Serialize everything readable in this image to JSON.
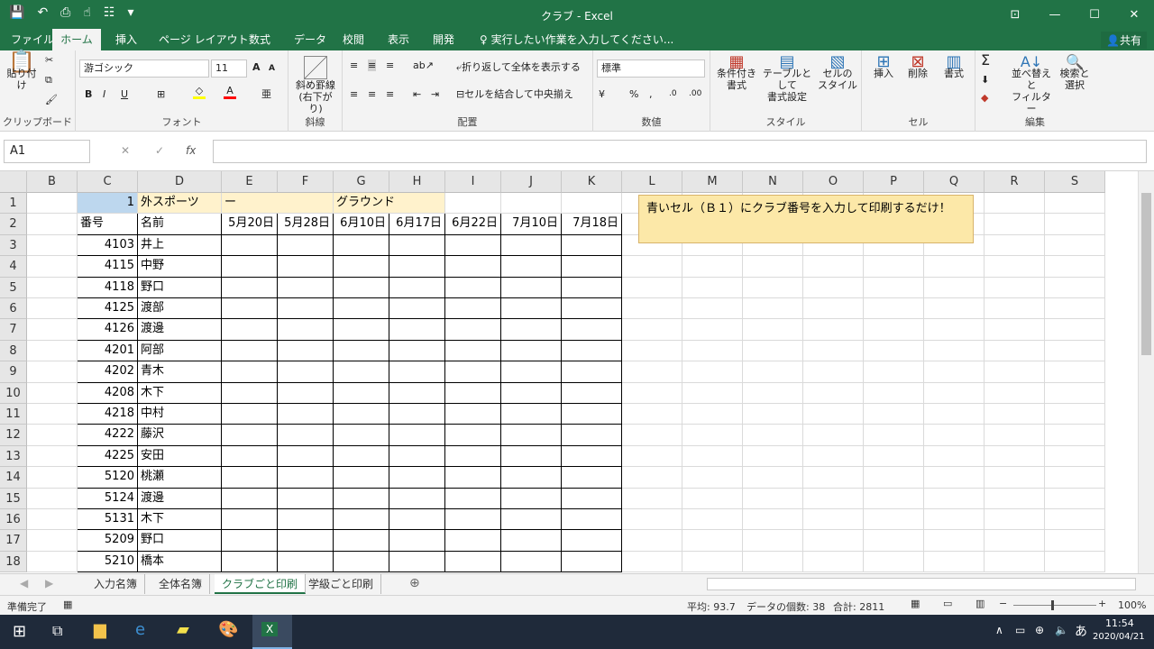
{
  "window": {
    "title": "クラブ - Excel"
  },
  "qat": {
    "save": "💾",
    "undo": "↶",
    "preview": "⎙",
    "touch": "☝",
    "form": "☷",
    "more": "▾"
  },
  "win_buttons": {
    "ribbon_opts": "⊡",
    "min": "—",
    "max": "☐",
    "close": "✕"
  },
  "tabs": [
    "ファイル",
    "ホーム",
    "挿入",
    "ページ レイアウト",
    "数式",
    "データ",
    "校閲",
    "表示",
    "開発"
  ],
  "tell_me": "実行したい作業を入力してください...",
  "share": "共有",
  "ribbon": {
    "clipboard": {
      "paste": "貼り付け",
      "label": "クリップボード"
    },
    "font": {
      "name": "游ゴシック",
      "size": "11",
      "label": "フォント",
      "bold": "B",
      "italic": "I",
      "underline": "U",
      "grow": "A",
      "shrink": "A",
      "fill_char": "◇",
      "font_color_char": "A",
      "fill_color": "#ffff00",
      "font_color": "#ff0000"
    },
    "border": {
      "diag": "斜め罫線",
      "diag2": "(右下がり)",
      "label": "斜線"
    },
    "align": {
      "wrap": "折り返して全体を表示する",
      "merge": "セルを結合して中央揃え",
      "label": "配置"
    },
    "number": {
      "format": "標準",
      "label": "数値",
      "percent": "%",
      "comma": ",",
      "inc": ".0",
      "dec": ".00"
    },
    "style": {
      "cond": "条件付き",
      "cond2": "書式",
      "table": "テーブルとして",
      "table2": "書式設定",
      "cell": "セルの",
      "cell2": "スタイル",
      "label": "スタイル"
    },
    "cells": {
      "insert": "挿入",
      "delete": "削除",
      "format": "書式",
      "label": "セル"
    },
    "edit": {
      "sort": "並べ替えと",
      "sort2": "フィルター",
      "find": "検索と",
      "find2": "選択",
      "label": "編集",
      "sum": "Σ"
    }
  },
  "namebox": "A1",
  "fx_label": "fx",
  "columns": [
    "B",
    "C",
    "D",
    "E",
    "F",
    "G",
    "H",
    "I",
    "J",
    "K",
    "L",
    "M",
    "N",
    "O",
    "P",
    "Q",
    "R",
    "S"
  ],
  "row1": {
    "c": "1",
    "d": "外スポーツ",
    "e": "ー",
    "g": "グラウンド"
  },
  "row2": {
    "c": "番号",
    "d": "名前",
    "dates": [
      "5月20日",
      "5月28日",
      "6月10日",
      "6月17日",
      "6月22日",
      "7月10日",
      "7月18日"
    ]
  },
  "rows": [
    {
      "n": "3",
      "num": "4103",
      "name": "井上"
    },
    {
      "n": "4",
      "num": "4115",
      "name": "中野"
    },
    {
      "n": "5",
      "num": "4118",
      "name": "野口"
    },
    {
      "n": "6",
      "num": "4125",
      "name": "渡部"
    },
    {
      "n": "7",
      "num": "4126",
      "name": "渡邊"
    },
    {
      "n": "8",
      "num": "4201",
      "name": "阿部"
    },
    {
      "n": "9",
      "num": "4202",
      "name": "青木"
    },
    {
      "n": "10",
      "num": "4208",
      "name": "木下"
    },
    {
      "n": "11",
      "num": "4218",
      "name": "中村"
    },
    {
      "n": "12",
      "num": "4222",
      "name": "藤沢"
    },
    {
      "n": "13",
      "num": "4225",
      "name": "安田"
    },
    {
      "n": "14",
      "num": "5120",
      "name": "桃瀬"
    },
    {
      "n": "15",
      "num": "5124",
      "name": "渡邊"
    },
    {
      "n": "16",
      "num": "5131",
      "name": "木下"
    },
    {
      "n": "17",
      "num": "5209",
      "name": "野口"
    },
    {
      "n": "18",
      "num": "5210",
      "name": "橋本"
    }
  ],
  "row_headers": [
    "1",
    "2"
  ],
  "note": "青いセル（Ｂ１）にクラブ番号を入力して印刷するだけ！",
  "sheets": [
    "入力名簿",
    "全体名簿",
    "クラブごと印刷",
    "学級ごと印刷"
  ],
  "status": {
    "ready": "準備完了",
    "avg": "平均: 93.7",
    "count": "データの個数: 38",
    "sum": "合計: 2811",
    "zoom": "100%"
  },
  "taskbar": {
    "time": "11:54",
    "date": "2020/04/21",
    "ime": "あ"
  },
  "colors": {
    "accent": "#217346",
    "note": "#fce8a8",
    "selected": "#bdd7ee",
    "header_fill": "#fff2cc"
  }
}
